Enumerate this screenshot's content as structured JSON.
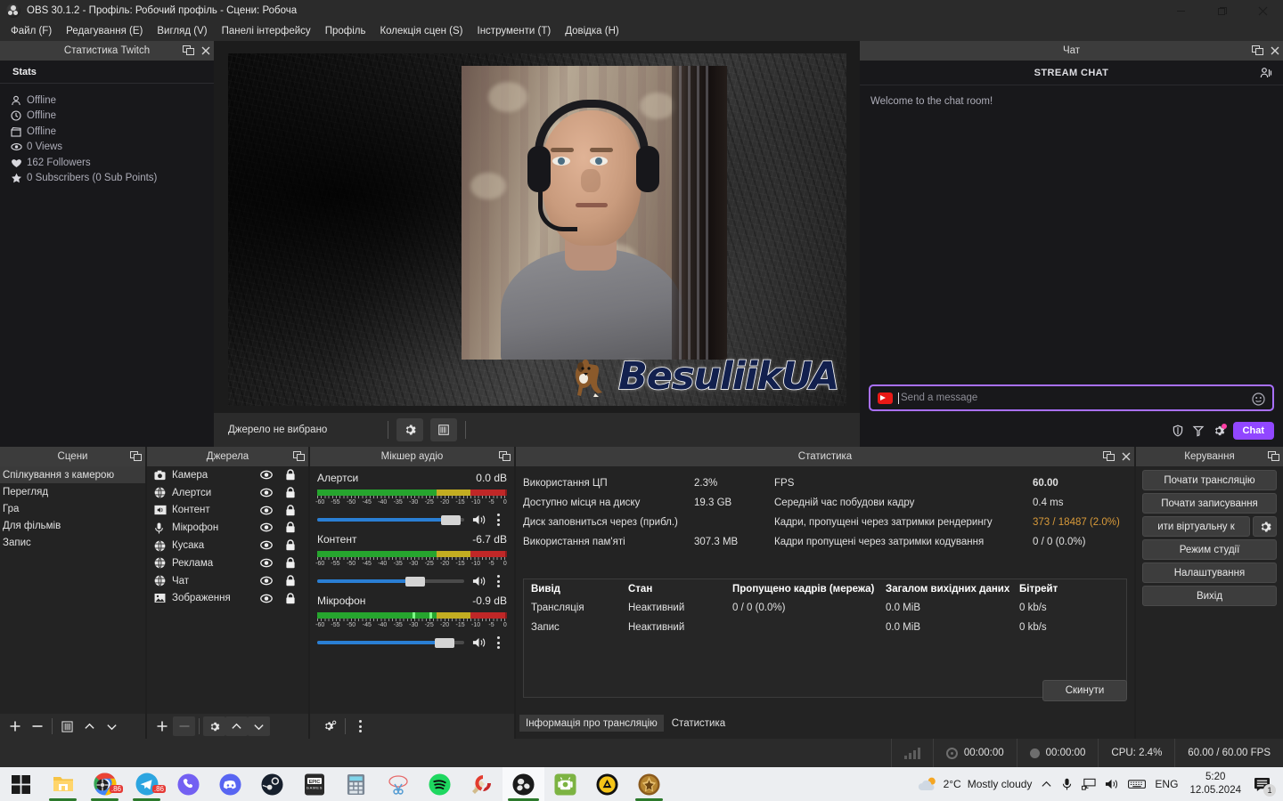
{
  "window": {
    "title": "OBS 30.1.2 - Профіль: Робочий профіль - Сцени: Робоча",
    "logo_icon": "obs-logo-icon",
    "minimize_icon": "minimize-icon",
    "maximize_icon": "maximize-icon",
    "close_icon": "close-icon"
  },
  "menu": [
    {
      "label": "Файл (F)"
    },
    {
      "label": "Редагування (E)"
    },
    {
      "label": "Вигляд (V)"
    },
    {
      "label": "Панелі інтерфейсу"
    },
    {
      "label": "Профіль"
    },
    {
      "label": "Колекція сцен (S)"
    },
    {
      "label": "Інструменти (T)"
    },
    {
      "label": "Довідка (H)"
    }
  ],
  "twitch_dock": {
    "title": "Статистика Twitch",
    "section_label": "Stats",
    "rows": [
      {
        "icon": "user-icon",
        "text": "Offline"
      },
      {
        "icon": "clock-icon",
        "text": "Offline"
      },
      {
        "icon": "clapperboard-icon",
        "text": "Offline"
      },
      {
        "icon": "eye-icon",
        "text": "0 Views"
      },
      {
        "icon": "heart-icon",
        "text": "162 Followers"
      },
      {
        "icon": "star-icon",
        "text": "0 Subscribers (0 Sub Points)"
      }
    ]
  },
  "preview": {
    "logo_text": "BesuliikUA",
    "toolbar": {
      "no_source_label": "Джерело не вибрано",
      "settings_icon": "gear-icon",
      "transition_icon": "transition-icon"
    }
  },
  "chat_dock": {
    "title": "Чат",
    "header": "STREAM CHAT",
    "users_icon": "users-icon",
    "messages": [
      "Welcome to the chat room!"
    ],
    "input_placeholder": "Send a message",
    "input_value": "",
    "emote_icon": "smiley-icon",
    "actions": [
      {
        "icon": "shield-icon"
      },
      {
        "icon": "bits-icon"
      },
      {
        "icon": "gear-icon"
      }
    ],
    "send_label": "Chat",
    "accent_color": "#9147ff"
  },
  "scenes_dock": {
    "title": "Сцени",
    "items": [
      {
        "label": "Спілкування з камерою",
        "selected": true
      },
      {
        "label": "Перегляд",
        "selected": false
      },
      {
        "label": "Гра",
        "selected": false
      },
      {
        "label": "Для фільмів",
        "selected": false
      },
      {
        "label": "Запис",
        "selected": false
      }
    ],
    "toolbar": [
      {
        "icon": "plus-icon"
      },
      {
        "icon": "minus-icon"
      },
      {
        "icon": "transition-icon"
      },
      {
        "icon": "chevron-up-icon"
      },
      {
        "icon": "chevron-down-icon"
      }
    ]
  },
  "sources_dock": {
    "title": "Джерела",
    "items": [
      {
        "label": "Камера",
        "icon": "camera-icon",
        "visible": true,
        "locked": true
      },
      {
        "label": "Алертси",
        "icon": "browser-icon",
        "visible": true,
        "locked": true
      },
      {
        "label": "Контент",
        "icon": "audio-output-icon",
        "visible": true,
        "locked": true
      },
      {
        "label": "Мікрофон",
        "icon": "microphone-icon",
        "visible": true,
        "locked": true
      },
      {
        "label": "Кусака",
        "icon": "browser-icon",
        "visible": true,
        "locked": true
      },
      {
        "label": "Реклама",
        "icon": "browser-icon",
        "visible": true,
        "locked": true
      },
      {
        "label": "Чат",
        "icon": "browser-icon",
        "visible": true,
        "locked": true
      },
      {
        "label": "Зображення",
        "icon": "image-icon",
        "visible": true,
        "locked": true
      }
    ],
    "toolbar": [
      {
        "icon": "plus-icon"
      },
      {
        "icon": "minus-icon"
      },
      {
        "icon": "gear-icon"
      },
      {
        "icon": "chevron-up-icon"
      },
      {
        "icon": "chevron-down-icon"
      }
    ]
  },
  "mixer_dock": {
    "title": "Мікшер аудіо",
    "tick_labels": [
      "-60",
      "-55",
      "-50",
      "-45",
      "-40",
      "-35",
      "-30",
      "-25",
      "-20",
      "-15",
      "-10",
      "-5",
      "0"
    ],
    "channels": [
      {
        "name": "Алертси",
        "db": "0.0 dB",
        "volume_percent": 92,
        "meter_percent": 100,
        "muted": false
      },
      {
        "name": "Контент",
        "db": "-6.7 dB",
        "volume_percent": 68,
        "meter_percent": 100,
        "muted": false
      },
      {
        "name": "Мікрофон",
        "db": "-0.9 dB",
        "volume_percent": 88,
        "meter_percent": 100,
        "muted": false
      }
    ],
    "toolbar": [
      {
        "icon": "advanced-audio-icon"
      },
      {
        "icon": "kebab-menu-icon"
      }
    ]
  },
  "stats_dock": {
    "title": "Статистика",
    "left_rows": [
      {
        "label": "Використання ЦП",
        "value": "2.3%"
      },
      {
        "label": "Доступно місця на диску",
        "value": "19.3 GB"
      },
      {
        "label": "Диск заповниться через (прибл.)",
        "value": ""
      },
      {
        "label": "Використання пам'яті",
        "value": "307.3 MB"
      }
    ],
    "right_rows": [
      {
        "label": "FPS",
        "value": "60.00",
        "style": "bold"
      },
      {
        "label": "Середній час побудови кадру",
        "value": "0.4 ms",
        "style": "normal"
      },
      {
        "label": "Кадри, пропущені через затримки рендерингу",
        "value": "373 / 18487 (2.0%)",
        "style": "warn"
      },
      {
        "label": "Кадри пропущені через затримки кодування",
        "value": "0 / 0 (0.0%)",
        "style": "normal"
      }
    ],
    "table": {
      "headers": [
        "Вивід",
        "Стан",
        "Пропущено кадрів (мережа)",
        "Загалом вихідних даних",
        "Бітрейт"
      ],
      "rows": [
        [
          "Трансляція",
          "Неактивний",
          "0 / 0 (0.0%)",
          "0.0 MiB",
          "0 kb/s"
        ],
        [
          "Запис",
          "Неактивний",
          "",
          "0.0 MiB",
          "0 kb/s"
        ]
      ]
    },
    "reset_label": "Скинути",
    "tabs": [
      {
        "label": "Інформація про трансляцію",
        "active": false
      },
      {
        "label": "Статистика",
        "active": true
      }
    ]
  },
  "controls_dock": {
    "title": "Керування",
    "buttons": [
      {
        "label": "Почати трансляцію"
      },
      {
        "label": "Почати записування"
      }
    ],
    "virtual_cam": {
      "label": "ити віртуальну к",
      "gear_icon": "gear-icon"
    },
    "buttons2": [
      {
        "label": "Режим студії"
      },
      {
        "label": "Налаштування"
      },
      {
        "label": "Вихід"
      }
    ]
  },
  "obs_status_bar": {
    "bitrate_icon": "signal-bars-icon",
    "stream_icon": "stream-dot-icon",
    "stream_time": "00:00:00",
    "record_icon": "record-dot-icon",
    "record_time": "00:00:00",
    "cpu": "CPU: 2.4%",
    "fps": "60.00 / 60.00 FPS"
  },
  "taskbar": {
    "start_icon": "windows-start-icon",
    "apps": [
      {
        "name": "file-explorer-icon",
        "running": true,
        "active": false
      },
      {
        "name": "chrome-icon",
        "running": true,
        "active": false,
        "badge": ".86"
      },
      {
        "name": "telegram-icon",
        "running": true,
        "active": false
      },
      {
        "name": "viber-icon",
        "running": false,
        "active": false
      },
      {
        "name": "discord-icon",
        "running": false,
        "active": false
      },
      {
        "name": "steam-icon",
        "running": false,
        "active": false
      },
      {
        "name": "epic-games-icon",
        "running": false,
        "active": false
      },
      {
        "name": "calculator-icon",
        "running": false,
        "active": false
      },
      {
        "name": "snipping-tool-icon",
        "running": false,
        "active": false
      },
      {
        "name": "spotify-icon",
        "running": false,
        "active": false
      },
      {
        "name": "ccleaner-icon",
        "running": false,
        "active": false
      },
      {
        "name": "obs-icon",
        "running": true,
        "active": true
      },
      {
        "name": "android-tool-icon",
        "running": false,
        "active": false
      },
      {
        "name": "aimp-icon",
        "running": false,
        "active": false
      },
      {
        "name": "game-icon",
        "running": true,
        "active": false
      }
    ],
    "tray": {
      "weather_icon": "partly-cloudy-icon",
      "weather_temp": "2°C",
      "weather_desc": "Mostly cloudy",
      "chevron_icon": "chevron-up-icon",
      "mic_icon": "microphone-icon",
      "network_icon": "network-icon",
      "volume_icon": "speaker-icon",
      "keyboard_icon": "keyboard-icon",
      "language": "ENG",
      "time": "5:20",
      "date": "12.05.2024",
      "notification_icon": "notification-icon",
      "notification_count": "1"
    }
  }
}
